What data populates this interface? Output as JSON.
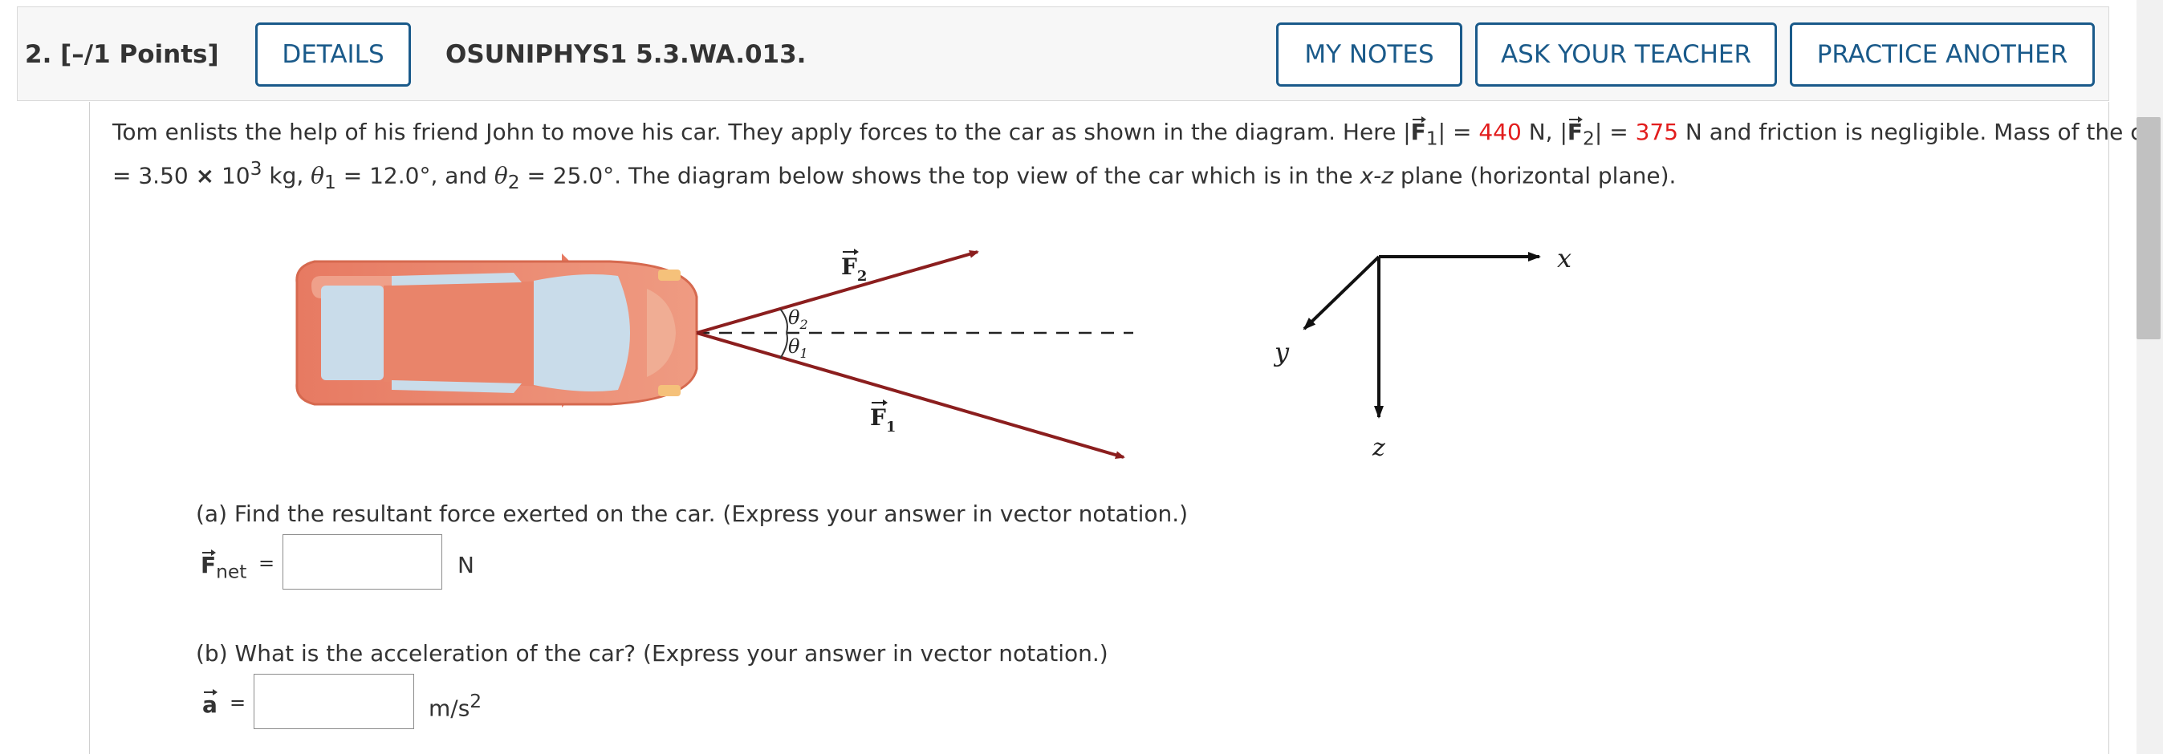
{
  "header": {
    "question_number": "2.  [–/1 Points]",
    "details_label": "DETAILS",
    "assignment_code": "OSUNIPHYS1 5.3.WA.013.",
    "my_notes_label": "MY NOTES",
    "ask_teacher_label": "ASK YOUR TEACHER",
    "practice_another_label": "PRACTICE ANOTHER"
  },
  "problem": {
    "line1_a": "Tom enlists the help of his friend John to move his car. They apply forces to the car as shown in the diagram. Here  |",
    "f1_symbol": "F",
    "f1_sub": "1",
    "f1_eq": "| = ",
    "f1_value": "440",
    "f1_unit": " N,   |",
    "f2_symbol": "F",
    "f2_sub": "2",
    "f2_eq": "| = ",
    "f2_value": "375",
    "f2_unit": " N  and friction is negligible. Mass of the car",
    "line2_a": "= 3.50 ",
    "line2_times": "×",
    "line2_b": " 10",
    "line2_exp": "3",
    "line2_c": " kg, ",
    "theta1": "θ",
    "theta1_sub": "1",
    "theta1_val": " = 12.0°, and ",
    "theta2": "θ",
    "theta2_sub": "2",
    "theta2_val": " = 25.0°. The diagram below shows the top view of the car which is in the ",
    "xz": "x-z",
    "line2_end": " plane (horizontal plane)."
  },
  "diagram": {
    "f2_label": "F",
    "f2_sub": "2",
    "f1_label": "F",
    "f1_sub": "1",
    "theta2_label": "θ",
    "theta2_sub": "2",
    "theta1_label": "θ",
    "theta1_sub": "1",
    "axis_x": "x",
    "axis_y": "y",
    "axis_z": "z",
    "colors": {
      "force_arrow": "#8b1e1e",
      "car_body": "#e8836a",
      "car_window": "#c9dcea"
    }
  },
  "part_a": {
    "prompt": "(a) Find the resultant force exerted on the car. (Express your answer in vector notation.)",
    "symbol": "F",
    "subscript": "net",
    "equals": "=",
    "input_value": "",
    "unit": "N"
  },
  "part_b": {
    "prompt": "(b) What is the acceleration of the car? (Express your answer in vector notation.)",
    "symbol": "a",
    "equals": "=",
    "input_value": "",
    "unit": "m/s",
    "unit_exp": "2"
  }
}
